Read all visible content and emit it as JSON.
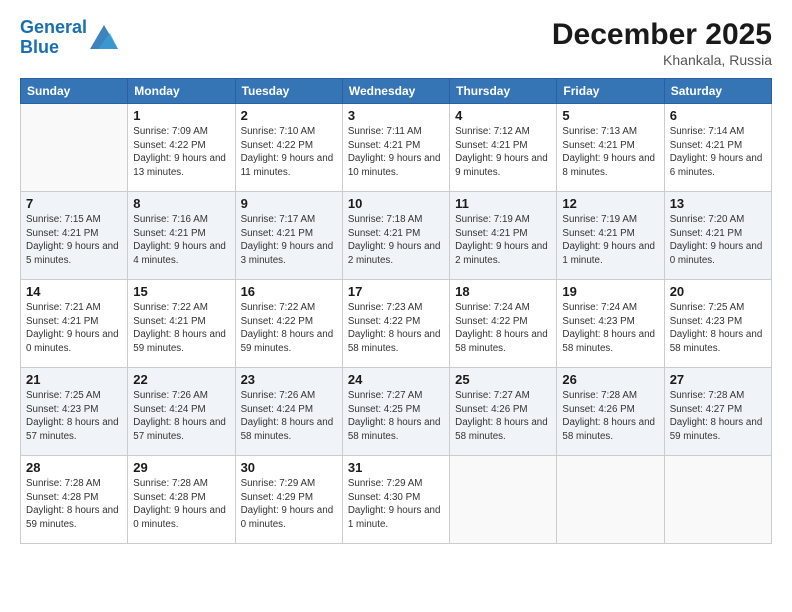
{
  "header": {
    "logo_line1": "General",
    "logo_line2": "Blue",
    "month": "December 2025",
    "location": "Khankala, Russia"
  },
  "days_of_week": [
    "Sunday",
    "Monday",
    "Tuesday",
    "Wednesday",
    "Thursday",
    "Friday",
    "Saturday"
  ],
  "weeks": [
    [
      {
        "day": "",
        "sunrise": "",
        "sunset": "",
        "daylight": ""
      },
      {
        "day": "1",
        "sunrise": "Sunrise: 7:09 AM",
        "sunset": "Sunset: 4:22 PM",
        "daylight": "Daylight: 9 hours and 13 minutes."
      },
      {
        "day": "2",
        "sunrise": "Sunrise: 7:10 AM",
        "sunset": "Sunset: 4:22 PM",
        "daylight": "Daylight: 9 hours and 11 minutes."
      },
      {
        "day": "3",
        "sunrise": "Sunrise: 7:11 AM",
        "sunset": "Sunset: 4:21 PM",
        "daylight": "Daylight: 9 hours and 10 minutes."
      },
      {
        "day": "4",
        "sunrise": "Sunrise: 7:12 AM",
        "sunset": "Sunset: 4:21 PM",
        "daylight": "Daylight: 9 hours and 9 minutes."
      },
      {
        "day": "5",
        "sunrise": "Sunrise: 7:13 AM",
        "sunset": "Sunset: 4:21 PM",
        "daylight": "Daylight: 9 hours and 8 minutes."
      },
      {
        "day": "6",
        "sunrise": "Sunrise: 7:14 AM",
        "sunset": "Sunset: 4:21 PM",
        "daylight": "Daylight: 9 hours and 6 minutes."
      }
    ],
    [
      {
        "day": "7",
        "sunrise": "Sunrise: 7:15 AM",
        "sunset": "Sunset: 4:21 PM",
        "daylight": "Daylight: 9 hours and 5 minutes."
      },
      {
        "day": "8",
        "sunrise": "Sunrise: 7:16 AM",
        "sunset": "Sunset: 4:21 PM",
        "daylight": "Daylight: 9 hours and 4 minutes."
      },
      {
        "day": "9",
        "sunrise": "Sunrise: 7:17 AM",
        "sunset": "Sunset: 4:21 PM",
        "daylight": "Daylight: 9 hours and 3 minutes."
      },
      {
        "day": "10",
        "sunrise": "Sunrise: 7:18 AM",
        "sunset": "Sunset: 4:21 PM",
        "daylight": "Daylight: 9 hours and 2 minutes."
      },
      {
        "day": "11",
        "sunrise": "Sunrise: 7:19 AM",
        "sunset": "Sunset: 4:21 PM",
        "daylight": "Daylight: 9 hours and 2 minutes."
      },
      {
        "day": "12",
        "sunrise": "Sunrise: 7:19 AM",
        "sunset": "Sunset: 4:21 PM",
        "daylight": "Daylight: 9 hours and 1 minute."
      },
      {
        "day": "13",
        "sunrise": "Sunrise: 7:20 AM",
        "sunset": "Sunset: 4:21 PM",
        "daylight": "Daylight: 9 hours and 0 minutes."
      }
    ],
    [
      {
        "day": "14",
        "sunrise": "Sunrise: 7:21 AM",
        "sunset": "Sunset: 4:21 PM",
        "daylight": "Daylight: 9 hours and 0 minutes."
      },
      {
        "day": "15",
        "sunrise": "Sunrise: 7:22 AM",
        "sunset": "Sunset: 4:21 PM",
        "daylight": "Daylight: 8 hours and 59 minutes."
      },
      {
        "day": "16",
        "sunrise": "Sunrise: 7:22 AM",
        "sunset": "Sunset: 4:22 PM",
        "daylight": "Daylight: 8 hours and 59 minutes."
      },
      {
        "day": "17",
        "sunrise": "Sunrise: 7:23 AM",
        "sunset": "Sunset: 4:22 PM",
        "daylight": "Daylight: 8 hours and 58 minutes."
      },
      {
        "day": "18",
        "sunrise": "Sunrise: 7:24 AM",
        "sunset": "Sunset: 4:22 PM",
        "daylight": "Daylight: 8 hours and 58 minutes."
      },
      {
        "day": "19",
        "sunrise": "Sunrise: 7:24 AM",
        "sunset": "Sunset: 4:23 PM",
        "daylight": "Daylight: 8 hours and 58 minutes."
      },
      {
        "day": "20",
        "sunrise": "Sunrise: 7:25 AM",
        "sunset": "Sunset: 4:23 PM",
        "daylight": "Daylight: 8 hours and 58 minutes."
      }
    ],
    [
      {
        "day": "21",
        "sunrise": "Sunrise: 7:25 AM",
        "sunset": "Sunset: 4:23 PM",
        "daylight": "Daylight: 8 hours and 57 minutes."
      },
      {
        "day": "22",
        "sunrise": "Sunrise: 7:26 AM",
        "sunset": "Sunset: 4:24 PM",
        "daylight": "Daylight: 8 hours and 57 minutes."
      },
      {
        "day": "23",
        "sunrise": "Sunrise: 7:26 AM",
        "sunset": "Sunset: 4:24 PM",
        "daylight": "Daylight: 8 hours and 58 minutes."
      },
      {
        "day": "24",
        "sunrise": "Sunrise: 7:27 AM",
        "sunset": "Sunset: 4:25 PM",
        "daylight": "Daylight: 8 hours and 58 minutes."
      },
      {
        "day": "25",
        "sunrise": "Sunrise: 7:27 AM",
        "sunset": "Sunset: 4:26 PM",
        "daylight": "Daylight: 8 hours and 58 minutes."
      },
      {
        "day": "26",
        "sunrise": "Sunrise: 7:28 AM",
        "sunset": "Sunset: 4:26 PM",
        "daylight": "Daylight: 8 hours and 58 minutes."
      },
      {
        "day": "27",
        "sunrise": "Sunrise: 7:28 AM",
        "sunset": "Sunset: 4:27 PM",
        "daylight": "Daylight: 8 hours and 59 minutes."
      }
    ],
    [
      {
        "day": "28",
        "sunrise": "Sunrise: 7:28 AM",
        "sunset": "Sunset: 4:28 PM",
        "daylight": "Daylight: 8 hours and 59 minutes."
      },
      {
        "day": "29",
        "sunrise": "Sunrise: 7:28 AM",
        "sunset": "Sunset: 4:28 PM",
        "daylight": "Daylight: 9 hours and 0 minutes."
      },
      {
        "day": "30",
        "sunrise": "Sunrise: 7:29 AM",
        "sunset": "Sunset: 4:29 PM",
        "daylight": "Daylight: 9 hours and 0 minutes."
      },
      {
        "day": "31",
        "sunrise": "Sunrise: 7:29 AM",
        "sunset": "Sunset: 4:30 PM",
        "daylight": "Daylight: 9 hours and 1 minute."
      },
      {
        "day": "",
        "sunrise": "",
        "sunset": "",
        "daylight": ""
      },
      {
        "day": "",
        "sunrise": "",
        "sunset": "",
        "daylight": ""
      },
      {
        "day": "",
        "sunrise": "",
        "sunset": "",
        "daylight": ""
      }
    ]
  ]
}
